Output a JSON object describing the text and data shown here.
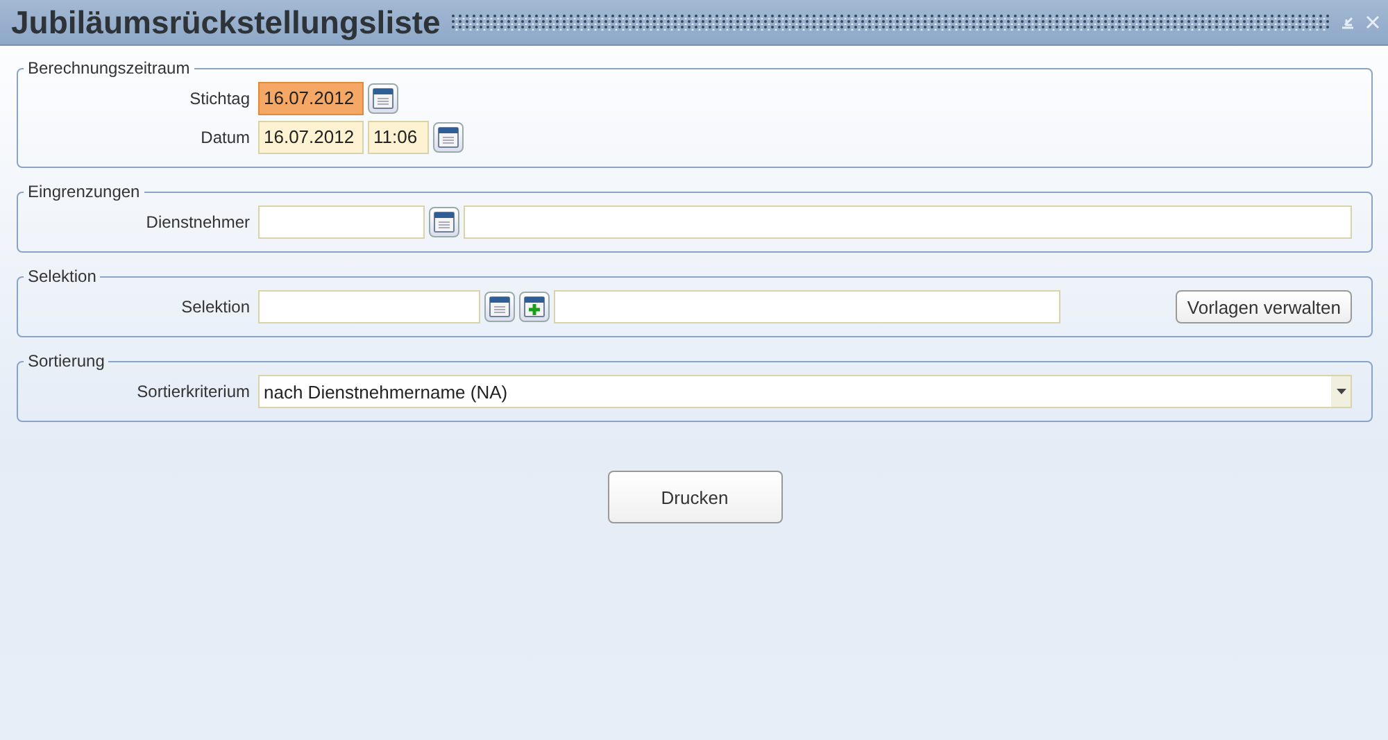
{
  "window": {
    "title": "Jubiläumsrückstellungsliste"
  },
  "groups": [
    {
      "legend": "Berechnungszeitraum",
      "rows": [
        {
          "label": "Stichtag",
          "items": [
            {
              "kind": "date-field",
              "value": "16.07.2012",
              "focused": true
            },
            {
              "kind": "calendar-button"
            }
          ]
        },
        {
          "label": "Datum",
          "items": [
            {
              "kind": "date-field",
              "value": "16.07.2012",
              "focused": false
            },
            {
              "kind": "time-field",
              "value": "11:06",
              "focused": false
            },
            {
              "kind": "calendar-button"
            }
          ]
        }
      ]
    },
    {
      "legend": "Eingrenzungen",
      "rows": [
        {
          "label": "Dienstnehmer",
          "items": [
            {
              "kind": "short-field",
              "focused": false
            },
            {
              "kind": "calendar-button"
            },
            {
              "kind": "flex-field",
              "focused": false
            }
          ]
        }
      ]
    },
    {
      "legend": "Selektion",
      "rows": [
        {
          "label": "Selektion",
          "items": [
            {
              "kind": "medium-field",
              "focused": false
            },
            {
              "kind": "calendar-button"
            },
            {
              "kind": "add-button"
            },
            {
              "kind": "wide-field",
              "focused": false
            },
            {
              "kind": "button",
              "label": "Vorlagen verwalten"
            }
          ]
        }
      ]
    },
    {
      "legend": "Sortierung",
      "rows": [
        {
          "label": "Sortierkriterium",
          "items": [
            {
              "kind": "select",
              "value": "nach Dienstnehmername (NA)"
            }
          ]
        }
      ]
    }
  ],
  "print_button": {
    "label": "Drucken"
  }
}
